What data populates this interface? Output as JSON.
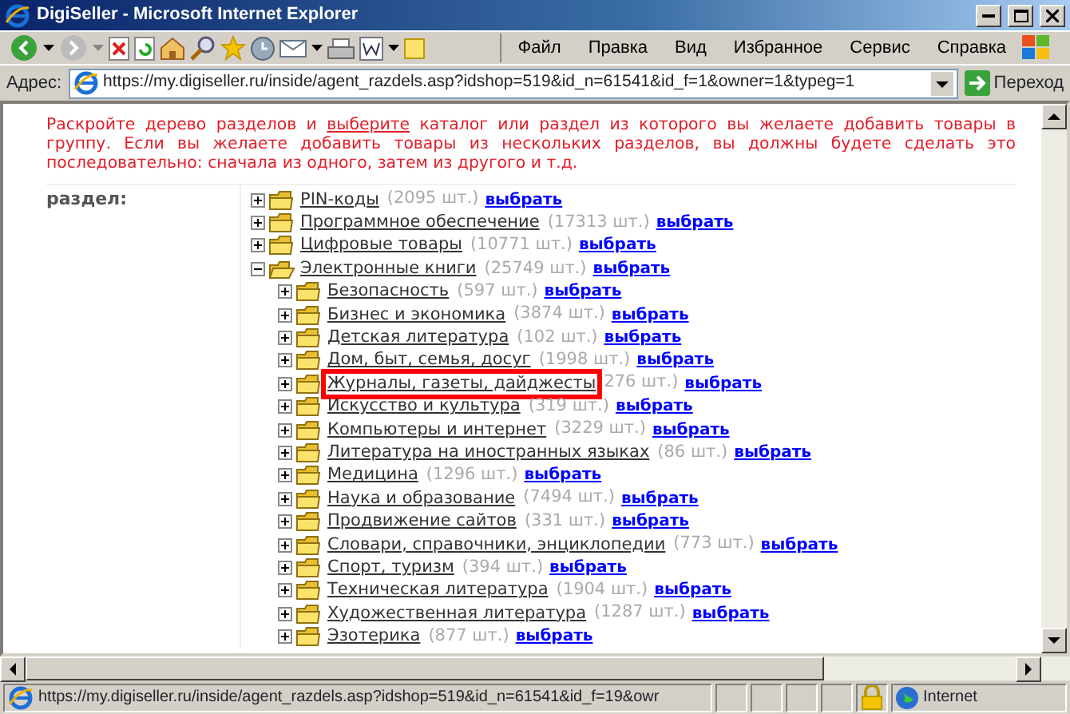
{
  "window": {
    "title": "DigiSeller - Microsoft Internet Explorer"
  },
  "menu": [
    "Файл",
    "Правка",
    "Вид",
    "Избранное",
    "Сервис",
    "Справка"
  ],
  "address": {
    "label": "Адрес:",
    "url": "https://my.digiseller.ru/inside/agent_razdels.asp?idshop=519&id_n=61541&id_f=1&owner=1&typeg=1",
    "go": "Переход"
  },
  "instruction": {
    "before": "Раскройте дерево разделов и ",
    "link": "выберите",
    "after": " каталог или раздел из которого вы желаете добавить товары в группу. Если вы желаете добавить товары из нескольких разделов, вы должны будете сделать это последовательно: сначала из одного, затем из другого и т.д."
  },
  "field_label": "раздел:",
  "tree": [
    {
      "name": "PIN-коды",
      "count": "(2095 шт.)",
      "action": "выбрать",
      "expanded": false,
      "highlighted": false
    },
    {
      "name": "Программное обеспечение",
      "count": "(17313 шт.)",
      "action": "выбрать",
      "expanded": false,
      "highlighted": false
    },
    {
      "name": "Цифровые товары",
      "count": "(10771 шт.)",
      "action": "выбрать",
      "expanded": false,
      "highlighted": false
    },
    {
      "name": "Электронные книги",
      "count": "(25749 шт.)",
      "action": "выбрать",
      "expanded": true,
      "highlighted": false,
      "children": [
        {
          "name": "Безопасность",
          "count": "(597 шт.)",
          "action": "выбрать",
          "expanded": false,
          "highlighted": false
        },
        {
          "name": "Бизнес и экономика",
          "count": "(3874 шт.)",
          "action": "выбрать",
          "expanded": false,
          "highlighted": false
        },
        {
          "name": "Детская литература",
          "count": "(102 шт.)",
          "action": "выбрать",
          "expanded": false,
          "highlighted": false
        },
        {
          "name": "Дом, быт, семья, досуг",
          "count": "(1998 шт.)",
          "action": "выбрать",
          "expanded": false,
          "highlighted": false
        },
        {
          "name": "Журналы, газеты, дайджесты",
          "count": "276 шт.)",
          "action": "выбрать",
          "expanded": false,
          "highlighted": true
        },
        {
          "name": "Искусство и культура",
          "count": "(319 шт.)",
          "action": "выбрать",
          "expanded": false,
          "highlighted": false
        },
        {
          "name": "Компьютеры и интернет",
          "count": "(3229 шт.)",
          "action": "выбрать",
          "expanded": false,
          "highlighted": false
        },
        {
          "name": "Литература на иностранных языках",
          "count": "(86 шт.)",
          "action": "выбрать",
          "expanded": false,
          "highlighted": false
        },
        {
          "name": "Медицина",
          "count": "(1296 шт.)",
          "action": "выбрать",
          "expanded": false,
          "highlighted": false
        },
        {
          "name": "Наука и образование",
          "count": "(7494 шт.)",
          "action": "выбрать",
          "expanded": false,
          "highlighted": false
        },
        {
          "name": "Продвижение сайтов",
          "count": "(331 шт.)",
          "action": "выбрать",
          "expanded": false,
          "highlighted": false
        },
        {
          "name": "Словари, справочники, энциклопедии",
          "count": "(773 шт.)",
          "action": "выбрать",
          "expanded": false,
          "highlighted": false
        },
        {
          "name": "Спорт, туризм",
          "count": "(394 шт.)",
          "action": "выбрать",
          "expanded": false,
          "highlighted": false
        },
        {
          "name": "Техническая литература",
          "count": "(1904 шт.)",
          "action": "выбрать",
          "expanded": false,
          "highlighted": false
        },
        {
          "name": "Художественная литература",
          "count": "(1287 шт.)",
          "action": "выбрать",
          "expanded": false,
          "highlighted": false
        },
        {
          "name": "Эзотерика",
          "count": "(877 шт.)",
          "action": "выбрать",
          "expanded": false,
          "highlighted": false
        }
      ]
    }
  ],
  "status_bar": {
    "url": "https://my.digiseller.ru/inside/agent_razdels.asp?idshop=519&id_n=61541&id_f=19&owr",
    "zone": "Internet"
  }
}
